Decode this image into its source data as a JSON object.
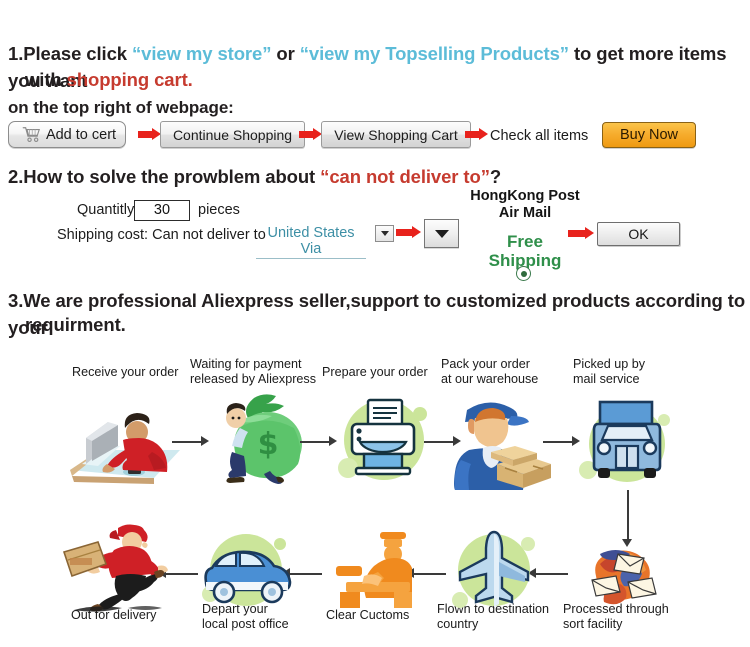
{
  "sections": {
    "s1": {
      "num": "1.",
      "t1": "Please click ",
      "link1": "“view my store”",
      "t2": " or ",
      "link2": "“view my Topselling Products”",
      "t3": " to get more items you want",
      "t4": "with ",
      "red": "shopping cart.",
      "subline": "on the top right of webpage:"
    },
    "s2": {
      "num": "2.",
      "t1": "How to solve the prowblem about ",
      "red": "“can not deliver to”",
      "t2": "?"
    },
    "s3": {
      "num": "3.",
      "t1": "We are professional Aliexpress seller,support to customized products according to your",
      "t2": "requirment."
    }
  },
  "buttons": {
    "add_to_cart": "Add to cert",
    "cart_icon": "shopping-cart-icon",
    "continue_shopping": "Continue Shopping",
    "view_shopping_cart": "View Shopping Cart",
    "check_all_items": "Check all items",
    "buy_now": "Buy Now",
    "ok": "OK"
  },
  "form": {
    "quantity_label": "Quantitly:",
    "quantity_value": "30",
    "pieces_label": "pieces",
    "shipping_label": "Shipping cost: Can not deliver to",
    "country_value": "United States Via",
    "dropdown_icon": "chevron-down-icon",
    "carrier_line1": "HongKong Post",
    "carrier_line2": "Air Mail",
    "free_shipping_line1": "Free",
    "free_shipping_line2": "Shipping",
    "radio_icon": "radio-selected-icon"
  },
  "colors": {
    "link_blue": "#5cbcd8",
    "alert_red": "#c63b2f",
    "arrow_red": "#e8221c",
    "free_green": "#2f8f4a",
    "blob_green": "#cbe59a",
    "buy_orange": "#f6ab2b"
  },
  "flow": {
    "steps_top": [
      {
        "caption": "Receive your order",
        "icon": "person-at-computer-icon"
      },
      {
        "caption": "Waiting for payment\nreleased by Aliexpress",
        "icon": "money-bag-icon"
      },
      {
        "caption": "Prepare your order",
        "icon": "printer-icon"
      },
      {
        "caption": "Pack your order\nat our warehouse",
        "icon": "warehouse-worker-boxes-icon"
      },
      {
        "caption": "Picked up by\nmail service",
        "icon": "mail-truck-icon"
      }
    ],
    "steps_bottom": [
      {
        "caption": "Out for delivery",
        "icon": "running-courier-icon"
      },
      {
        "caption": "Depart your\nlocal post office",
        "icon": "delivery-van-icon"
      },
      {
        "caption": "Clear Cuctoms",
        "icon": "customs-officer-icon"
      },
      {
        "caption": "Flown to destination\ncountry",
        "icon": "airplane-icon"
      },
      {
        "caption": "Processed through\nsort facility",
        "icon": "mail-sorting-icon"
      }
    ]
  }
}
